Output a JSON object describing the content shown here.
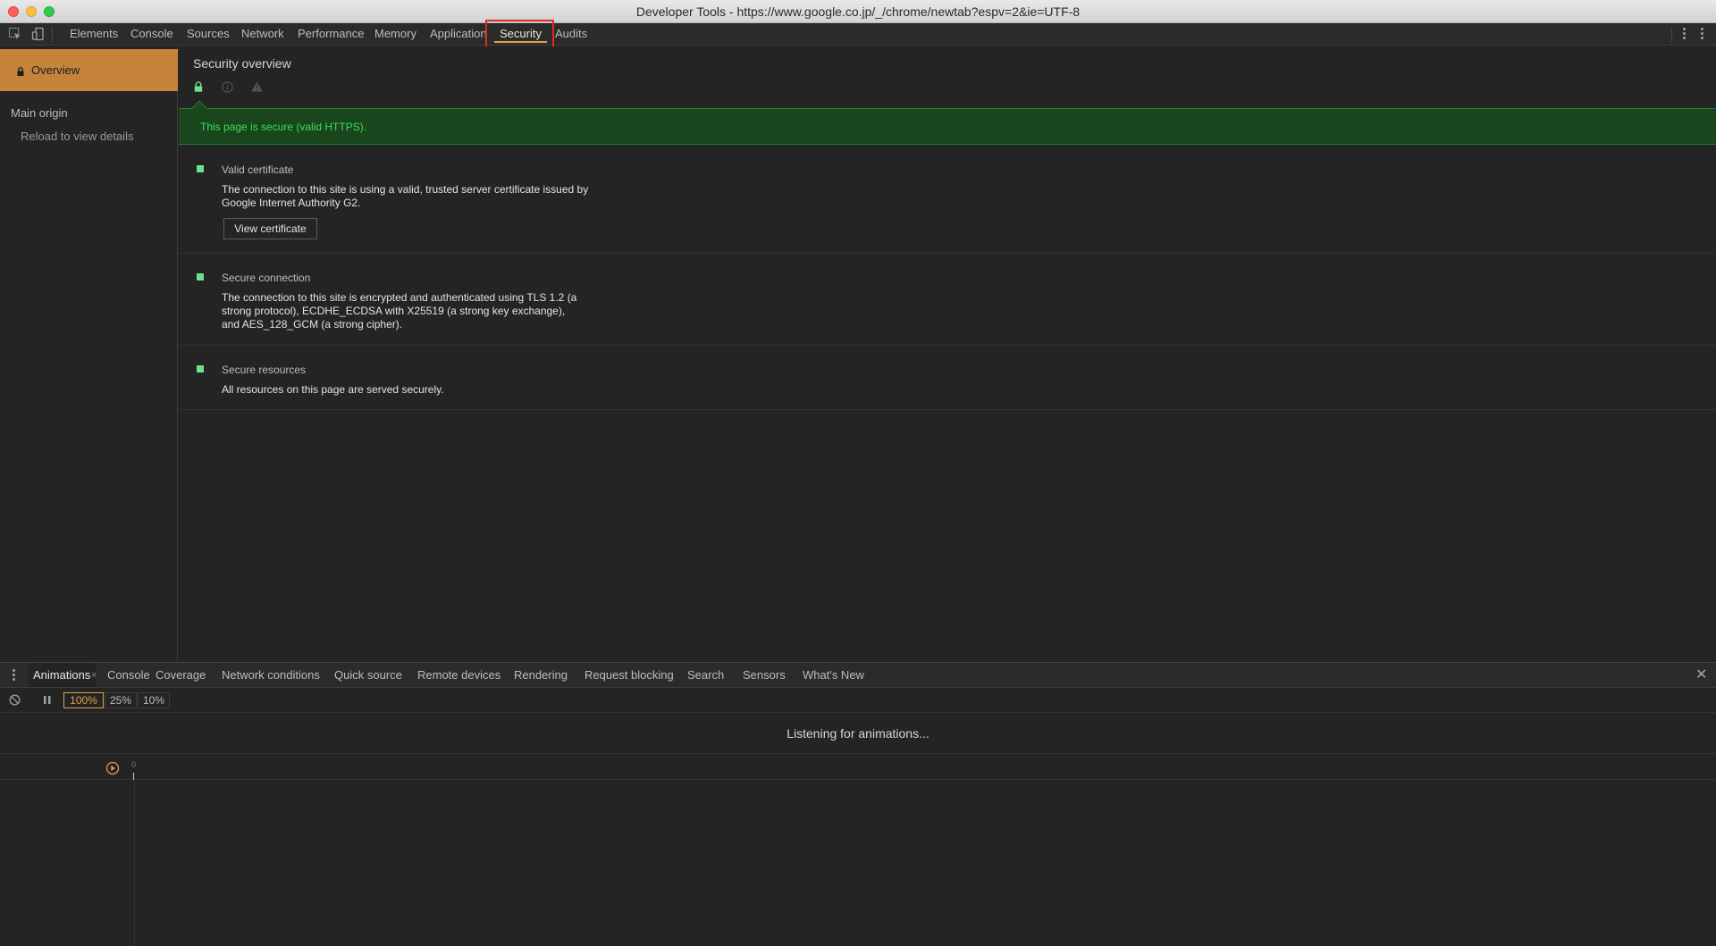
{
  "window": {
    "title": "Developer Tools - https://www.google.co.jp/_/chrome/newtab?espv=2&ie=UTF-8"
  },
  "toolbar": {
    "icons": [
      "inspect-element-icon",
      "device-toggle-icon",
      "more-vertical-icon"
    ],
    "tabs": [
      {
        "label": "Elements"
      },
      {
        "label": "Console"
      },
      {
        "label": "Sources"
      },
      {
        "label": "Network"
      },
      {
        "label": "Performance"
      },
      {
        "label": "Memory"
      },
      {
        "label": "Application"
      },
      {
        "label": "Security",
        "active": true
      },
      {
        "label": "Audits"
      }
    ]
  },
  "sidebar": {
    "overview_label": "Overview",
    "main_origin_label": "Main origin",
    "reload_label": "Reload to view details"
  },
  "main": {
    "title": "Security overview",
    "filter_icons": [
      "lock-icon",
      "info-icon",
      "warning-icon"
    ],
    "summary": "This page is secure (valid HTTPS).",
    "sections": [
      {
        "heading": "Valid certificate",
        "description": "The connection to this site is using a valid, trusted server certificate issued by Google Internet Authority G2.",
        "button_label": "View certificate"
      },
      {
        "heading": "Secure connection",
        "description": "The connection to this site is encrypted and authenticated using TLS 1.2 (a strong protocol), ECDHE_ECDSA with X25519 (a strong key exchange), and AES_128_GCM (a strong cipher)."
      },
      {
        "heading": "Secure resources",
        "description": "All resources on this page are served securely."
      }
    ]
  },
  "drawer": {
    "tabs": [
      {
        "label": "Animations",
        "active": true,
        "closable": true
      },
      {
        "label": "Console"
      },
      {
        "label": "Coverage"
      },
      {
        "label": "Network conditions"
      },
      {
        "label": "Quick source"
      },
      {
        "label": "Remote devices"
      },
      {
        "label": "Rendering"
      },
      {
        "label": "Request blocking"
      },
      {
        "label": "Search"
      },
      {
        "label": "Sensors"
      },
      {
        "label": "What's New"
      }
    ],
    "close_glyph": "✕",
    "tab_close_glyph": "×",
    "speeds": [
      {
        "label": "100%",
        "active": true
      },
      {
        "label": "25%"
      },
      {
        "label": "10%"
      }
    ],
    "listening_text": "Listening for animations...",
    "timeline_zero": "0"
  },
  "colors": {
    "accent": "#e0a24a",
    "overview_bg": "#c5833c",
    "secure_green": "#3fdc5a",
    "secure_bg": "#19461d"
  }
}
